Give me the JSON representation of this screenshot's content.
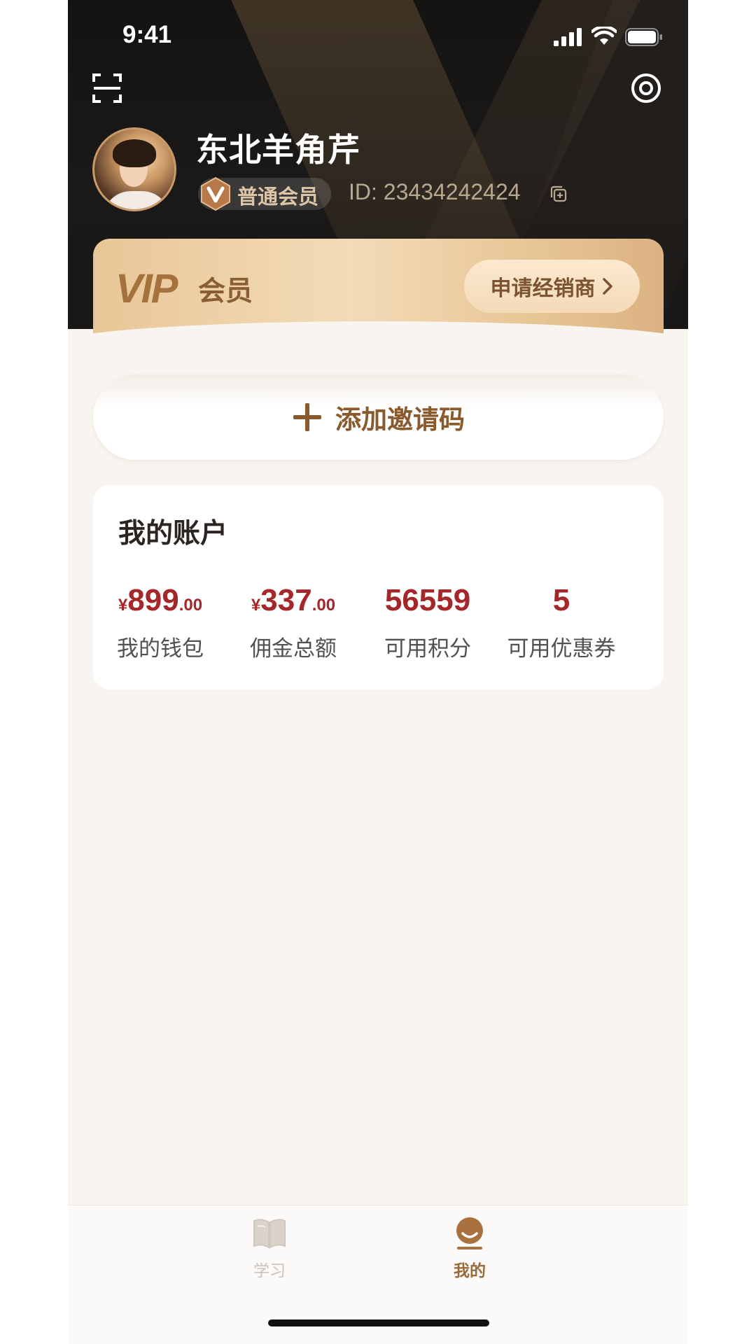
{
  "status_bar": {
    "time": "9:41"
  },
  "profile": {
    "name": "东北羊角芹",
    "member_level": "普通会员",
    "user_id": "ID: 23434242424"
  },
  "vip": {
    "logo": "VIP",
    "label": "会员",
    "apply_button": "申请经销商"
  },
  "invite": {
    "label": "添加邀请码"
  },
  "account": {
    "title": "我的账户",
    "stats": [
      {
        "currency": "¥",
        "int": "899",
        "dec": ".00",
        "label": "我的钱包"
      },
      {
        "currency": "¥",
        "int": "337",
        "dec": ".00",
        "label": "佣金总额"
      },
      {
        "value": "56559",
        "label": "可用积分"
      },
      {
        "value": "5",
        "label": "可用优惠券"
      }
    ]
  },
  "tab_bar": {
    "items": [
      {
        "label": "学习",
        "icon": "book-icon",
        "active": false
      },
      {
        "label": "我的",
        "icon": "user-icon",
        "active": true
      }
    ]
  },
  "colors": {
    "header_bg": "#1a1816",
    "gold": "#a5713d",
    "value_red": "#a4272a",
    "page_bg": "#f8f4ef"
  }
}
